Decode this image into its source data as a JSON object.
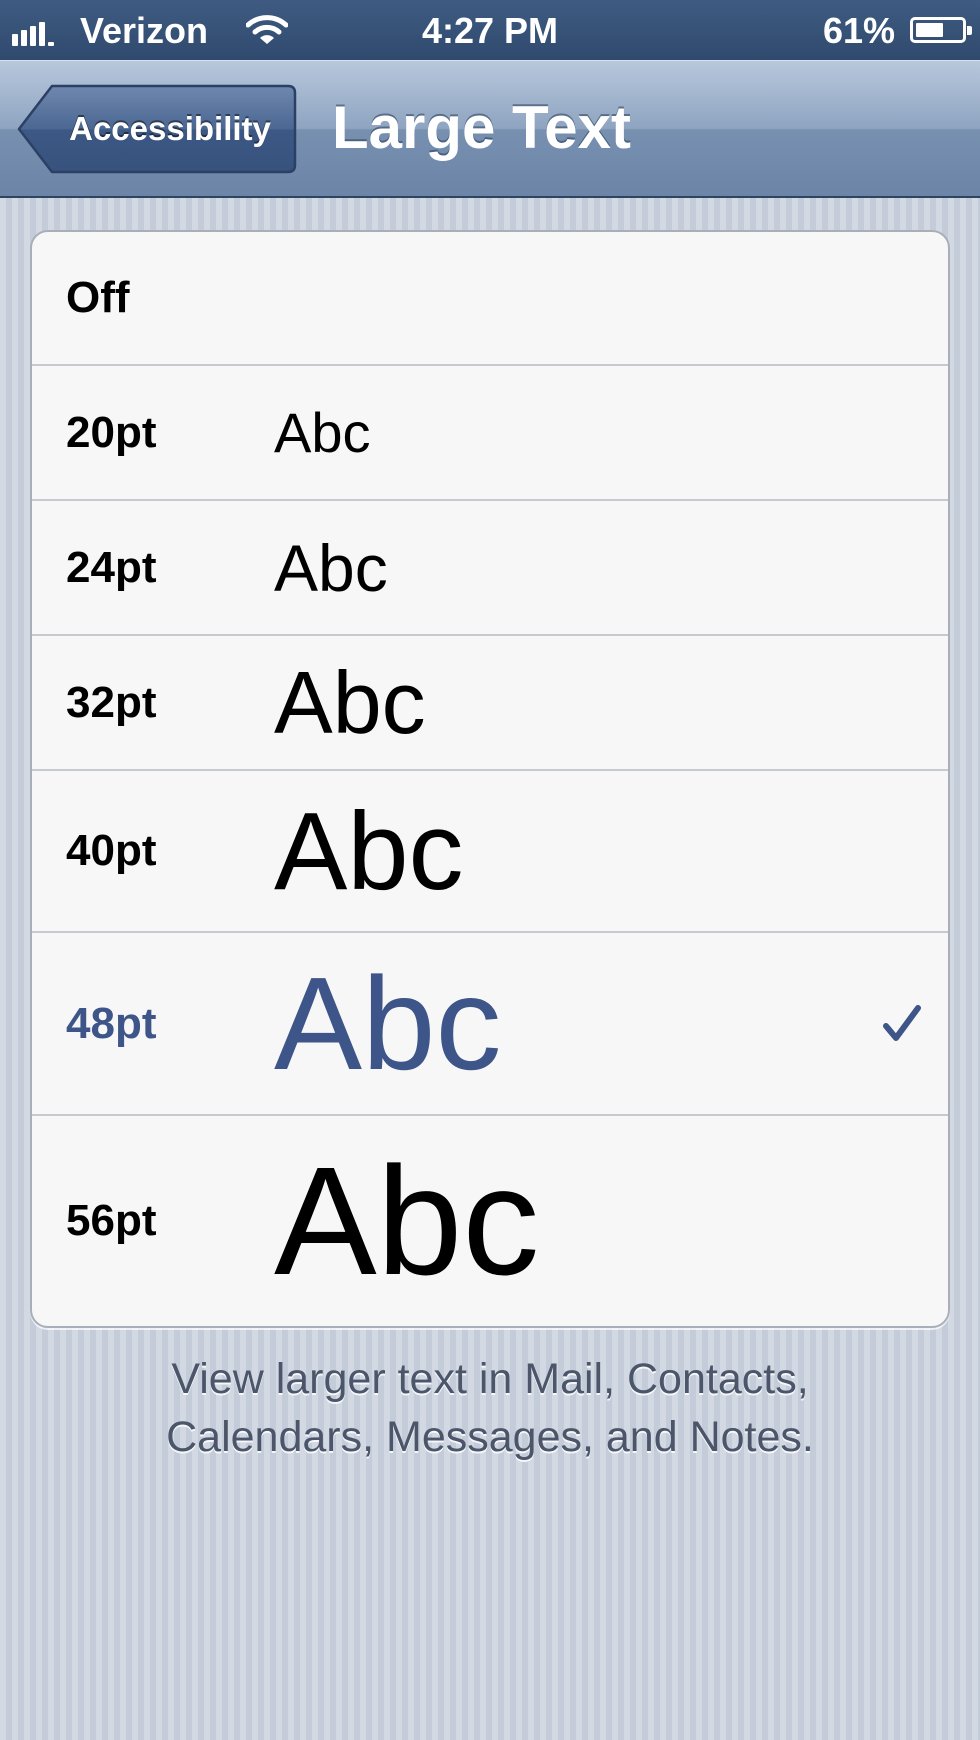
{
  "status_bar": {
    "carrier": "Verizon",
    "time": "4:27 PM",
    "battery_percent": "61%",
    "battery_level": 0.61,
    "signal_bars": 4,
    "icons": [
      "signal-bars-icon",
      "wifi-icon",
      "battery-icon"
    ]
  },
  "nav": {
    "back_label": "Accessibility",
    "title": "Large Text"
  },
  "options": [
    {
      "label": "Off",
      "sample": ""
    },
    {
      "label": "20pt",
      "sample": "Abc"
    },
    {
      "label": "24pt",
      "sample": "Abc"
    },
    {
      "label": "32pt",
      "sample": "Abc"
    },
    {
      "label": "40pt",
      "sample": "Abc"
    },
    {
      "label": "48pt",
      "sample": "Abc",
      "selected": true
    },
    {
      "label": "56pt",
      "sample": "Abc"
    }
  ],
  "footer": {
    "line1": "View larger text in Mail, Contacts,",
    "line2": "Calendars, Messages, and Notes."
  },
  "colors": {
    "selected_text": "#3d5588",
    "nav_bar": "#7890b0",
    "background": "#cbd2de"
  }
}
